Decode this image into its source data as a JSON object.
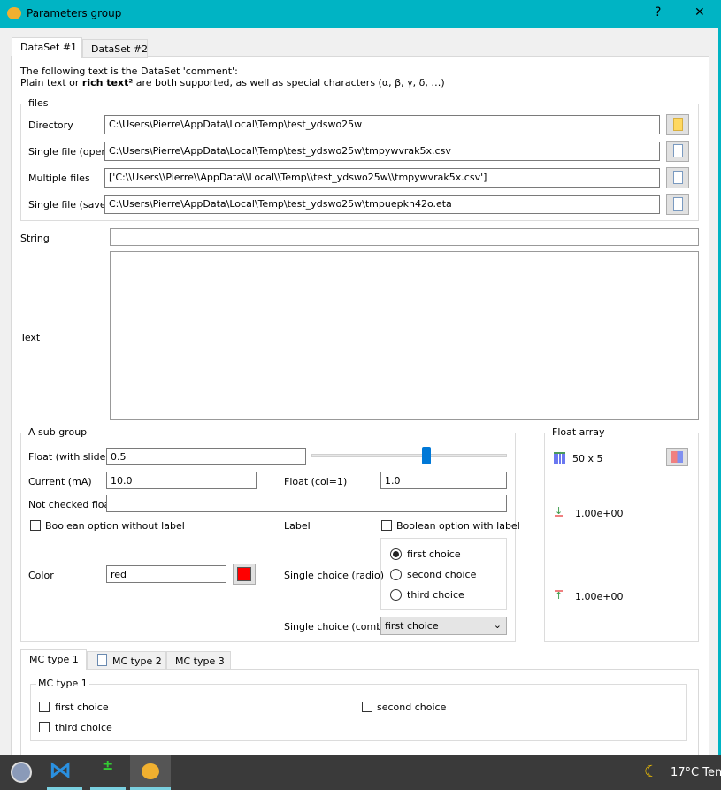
{
  "window": {
    "title": "Parameters group",
    "help": "?",
    "close": "✕"
  },
  "tabs": [
    {
      "label": "DataSet #1",
      "active": true
    },
    {
      "label": "DataSet #2",
      "active": false
    }
  ],
  "comment": {
    "line1": "The following text is the DataSet 'comment':",
    "line2_pre": "Plain text or ",
    "line2_bold": "rich text²",
    "line2_post": " are both supported, as well as special characters (α, β, γ, δ, …)"
  },
  "files": {
    "title": "files",
    "rows": [
      {
        "label": "Directory",
        "value": "C:\\Users\\Pierre\\AppData\\Local\\Temp\\test_ydswo25w",
        "icon": "folder-icon"
      },
      {
        "label": "Single file (open)",
        "value": "C:\\Users\\Pierre\\AppData\\Local\\Temp\\test_ydswo25w\\tmpywvrak5x.csv",
        "icon": "file-icon"
      },
      {
        "label": "Multiple files",
        "value": "['C:\\\\Users\\\\Pierre\\\\AppData\\\\Local\\\\Temp\\\\test_ydswo25w\\\\tmpywvrak5x.csv']",
        "icon": "file-icon"
      },
      {
        "label": "Single file (save)",
        "value": "C:\\Users\\Pierre\\AppData\\Local\\Temp\\test_ydswo25w\\tmpuepkn42o.eta",
        "icon": "file-icon"
      }
    ]
  },
  "string": {
    "label": "String",
    "value": ""
  },
  "text": {
    "label": "Text",
    "value": ""
  },
  "subgroup": {
    "title": "A sub group",
    "float_slider": {
      "label": "Float (with slider)",
      "value": "0.5",
      "slider_fraction": 0.6
    },
    "current": {
      "label": "Current (mA)",
      "value": "10.0"
    },
    "float_col": {
      "label": "Float (col=1)",
      "value": "1.0"
    },
    "not_checked": {
      "label": "Not checked float",
      "value": ""
    },
    "bool_nolabel": {
      "label": "Boolean option without label",
      "checked": false
    },
    "label_text": "Label",
    "bool_label": {
      "label": "Boolean option with label",
      "checked": false
    },
    "color": {
      "label": "Color",
      "value": "red",
      "swatch": "#ff0000"
    },
    "radio": {
      "label": "Single choice (radio)",
      "options": [
        "first choice",
        "second choice",
        "third choice"
      ],
      "selected": 0
    },
    "combo": {
      "label": "Single choice (combo)",
      "value": "first choice"
    }
  },
  "float_array": {
    "title": "Float array",
    "shape": "50 x 5",
    "min": "1.00e+00",
    "max": "1.00e+00"
  },
  "mc_tabs": [
    {
      "label": "MC type 1",
      "active": true
    },
    {
      "label": "MC type 2",
      "active": false
    },
    {
      "label": "MC type 3",
      "active": false
    }
  ],
  "mc_group": {
    "title": "MC type 1",
    "options": [
      {
        "label": "first choice",
        "checked": false
      },
      {
        "label": "second choice",
        "checked": false
      },
      {
        "label": "third choice",
        "checked": false
      }
    ]
  },
  "taskbar": {
    "weather": "17°C",
    "weather_extra": "Ten"
  }
}
